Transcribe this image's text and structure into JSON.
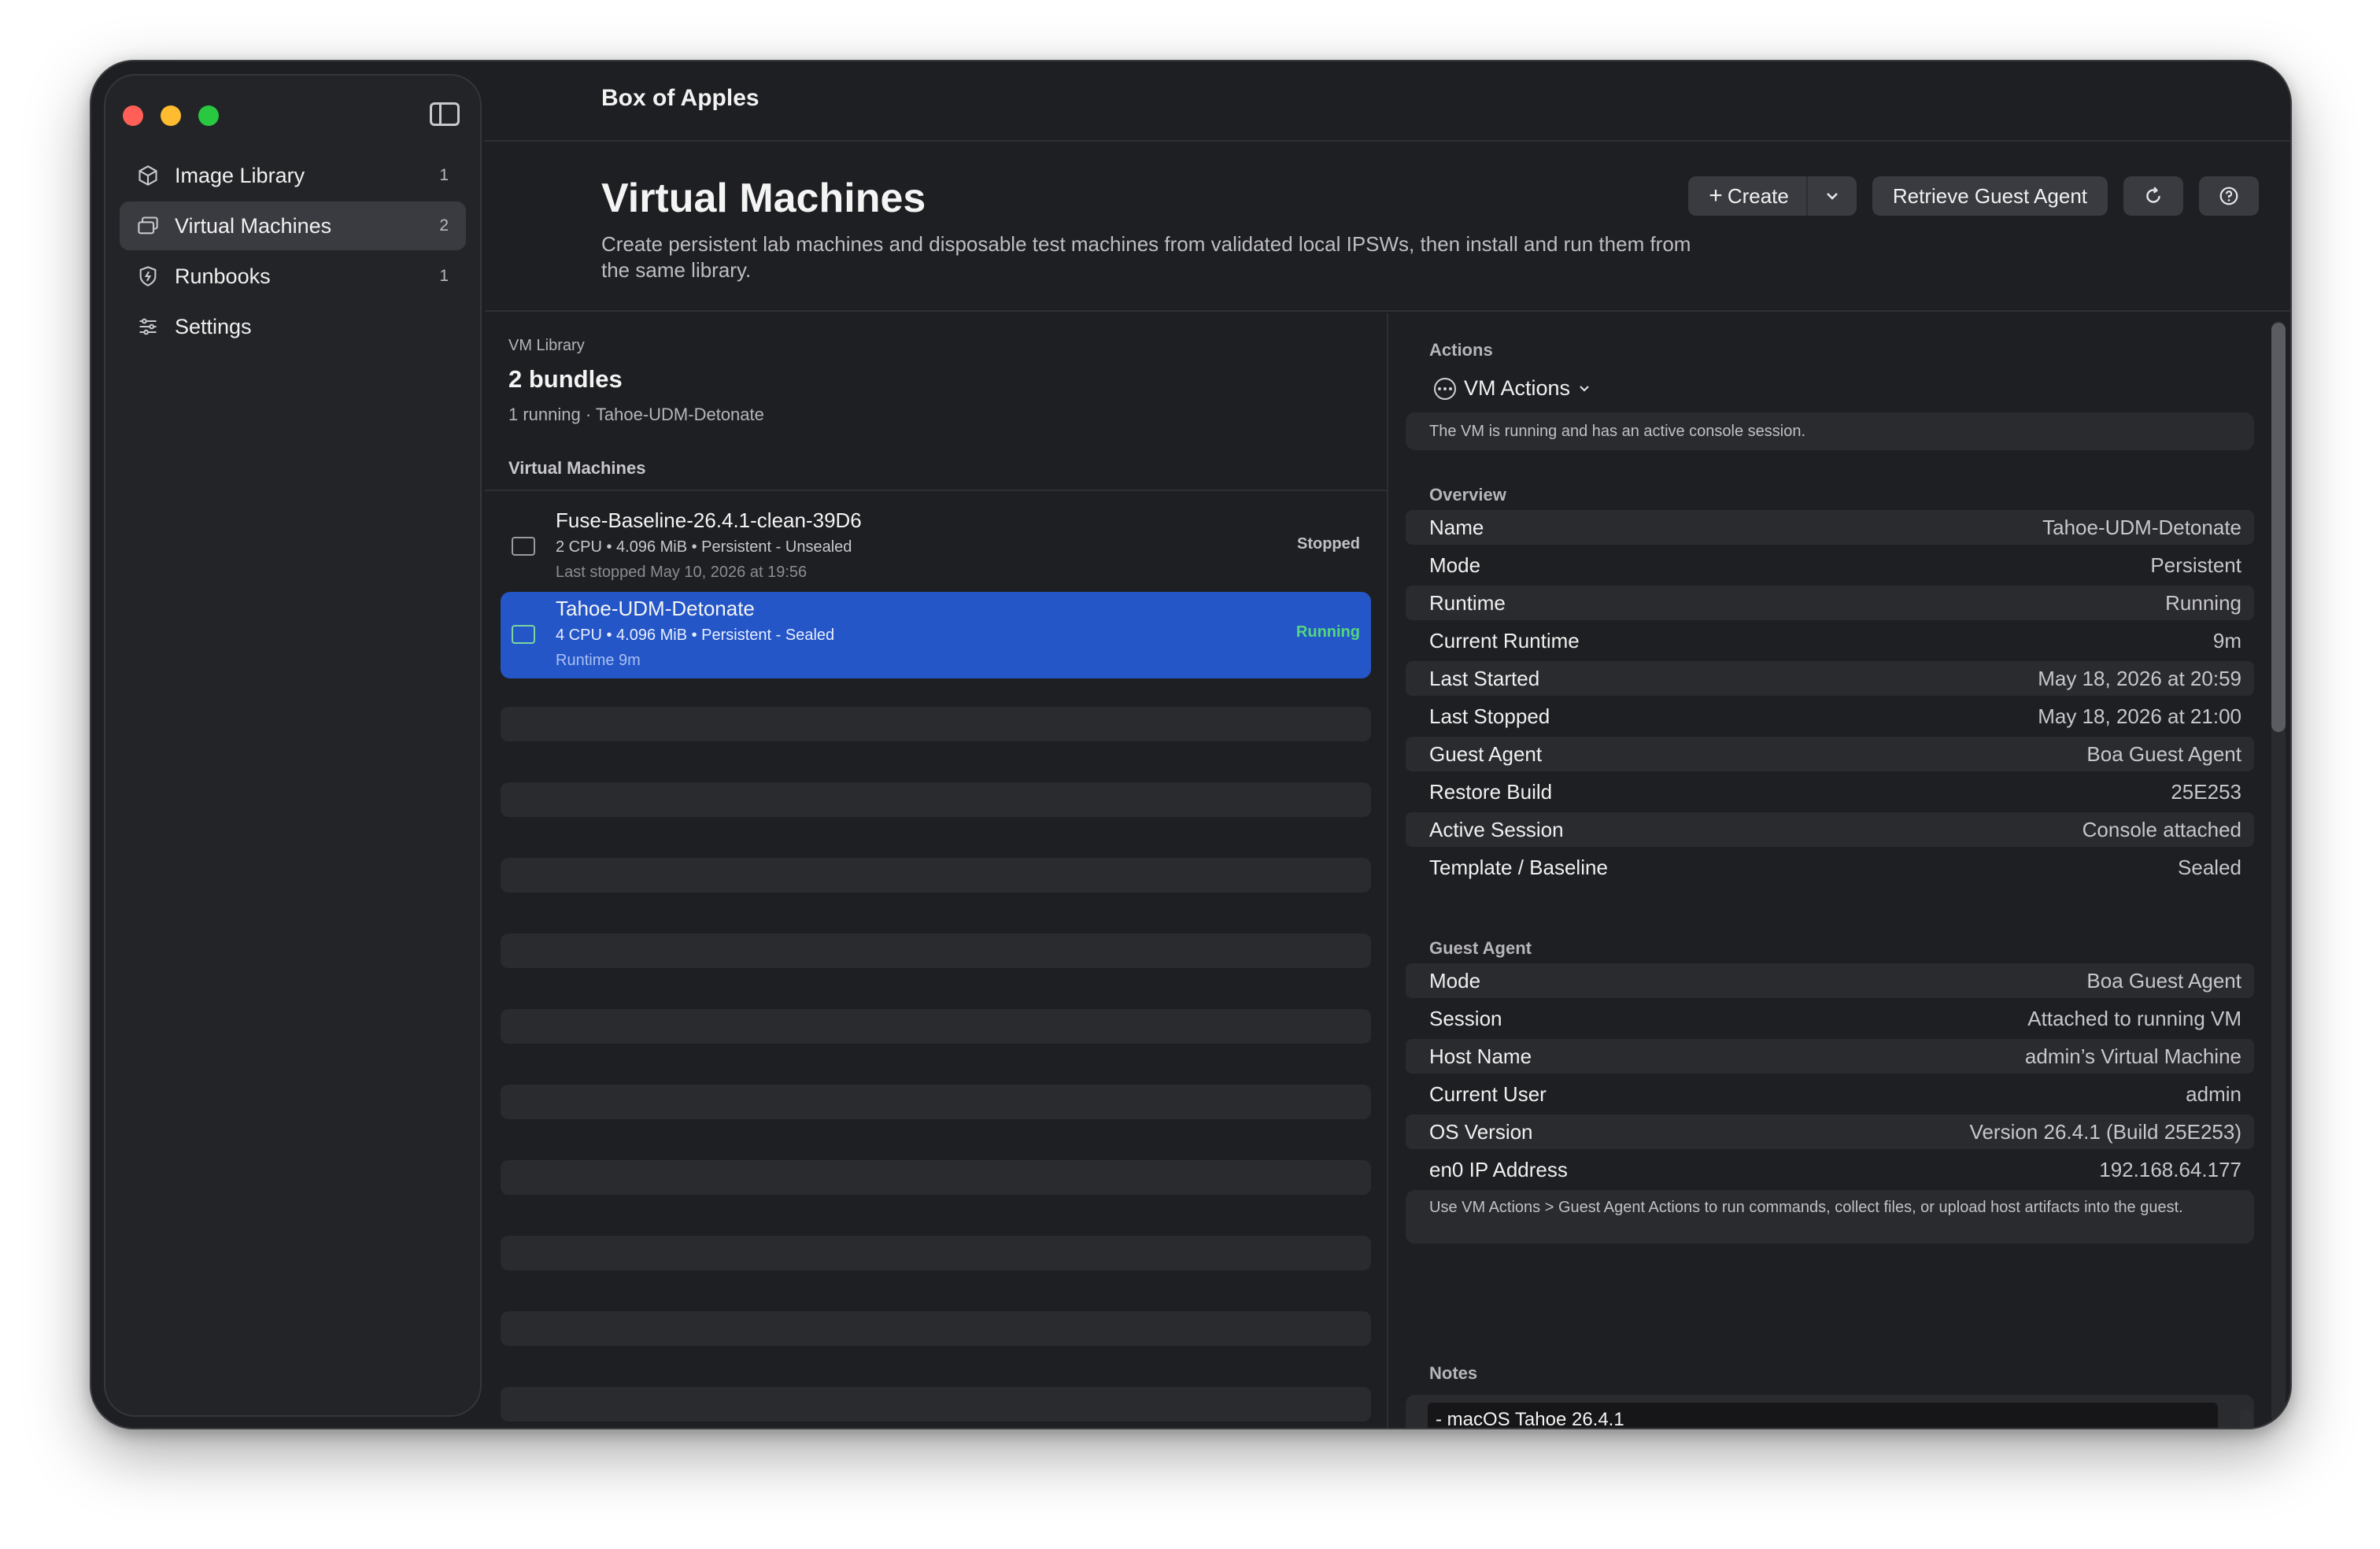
{
  "app": {
    "title": "Box of Apples"
  },
  "sidebar": {
    "items": [
      {
        "label": "Image Library",
        "count": "1",
        "icon": "cube-icon"
      },
      {
        "label": "Virtual Machines",
        "count": "2",
        "icon": "windows-icon"
      },
      {
        "label": "Runbooks",
        "count": "1",
        "icon": "shield-icon"
      },
      {
        "label": "Settings",
        "count": "",
        "icon": "sliders-icon"
      }
    ]
  },
  "header": {
    "title": "Virtual Machines",
    "subtitle": "Create persistent lab machines and disposable test machines from validated local IPSWs, then install and run them from the same library.",
    "create_label": "Create",
    "retrieve_label": "Retrieve Guest Agent"
  },
  "library": {
    "label": "VM Library",
    "count": "2 bundles",
    "status": "1 running · Tahoe-UDM-Detonate",
    "section_title": "Virtual Machines",
    "vms": [
      {
        "name": "Fuse-Baseline-26.4.1-clean-39D6",
        "spec": "2 CPU • 4.096 MiB • Persistent - Unsealed",
        "meta": "Last stopped May 10, 2026 at 19:56",
        "status": "Stopped"
      },
      {
        "name": "Tahoe-UDM-Detonate",
        "spec": "4 CPU • 4.096 MiB • Persistent - Sealed",
        "meta": "Runtime 9m",
        "status": "Running"
      }
    ]
  },
  "detail": {
    "actions_title": "Actions",
    "vm_actions_label": "VM Actions",
    "actions_note": "The VM is running and has an active console session.",
    "overview_title": "Overview",
    "overview": [
      {
        "key": "Name",
        "value": "Tahoe-UDM-Detonate"
      },
      {
        "key": "Mode",
        "value": "Persistent"
      },
      {
        "key": "Runtime",
        "value": "Running"
      },
      {
        "key": "Current Runtime",
        "value": "9m"
      },
      {
        "key": "Last Started",
        "value": "May 18, 2026 at 20:59"
      },
      {
        "key": "Last Stopped",
        "value": "May 18, 2026 at 21:00"
      },
      {
        "key": "Guest Agent",
        "value": "Boa Guest Agent"
      },
      {
        "key": "Restore Build",
        "value": "25E253"
      },
      {
        "key": "Active Session",
        "value": "Console attached"
      },
      {
        "key": "Template / Baseline",
        "value": "Sealed"
      }
    ],
    "guest_title": "Guest Agent",
    "guest": [
      {
        "key": "Mode",
        "value": "Boa Guest Agent"
      },
      {
        "key": "Session",
        "value": "Attached to running VM"
      },
      {
        "key": "Host Name",
        "value": "admin’s Virtual Machine"
      },
      {
        "key": "Current User",
        "value": "admin"
      },
      {
        "key": "OS Version",
        "value": "Version 26.4.1 (Build 25E253)"
      },
      {
        "key": "en0 IP Address",
        "value": "192.168.64.177"
      }
    ],
    "guest_note": "Use VM Actions > Guest Agent Actions to run commands, collect files, or upload host artifacts into the guest.",
    "notes_title": "Notes",
    "notes_text": "- macOS Tahoe 26.4.1"
  },
  "colors": {
    "accent": "#2456c8",
    "running": "#54d67e",
    "window_bg": "#1e1f22"
  }
}
